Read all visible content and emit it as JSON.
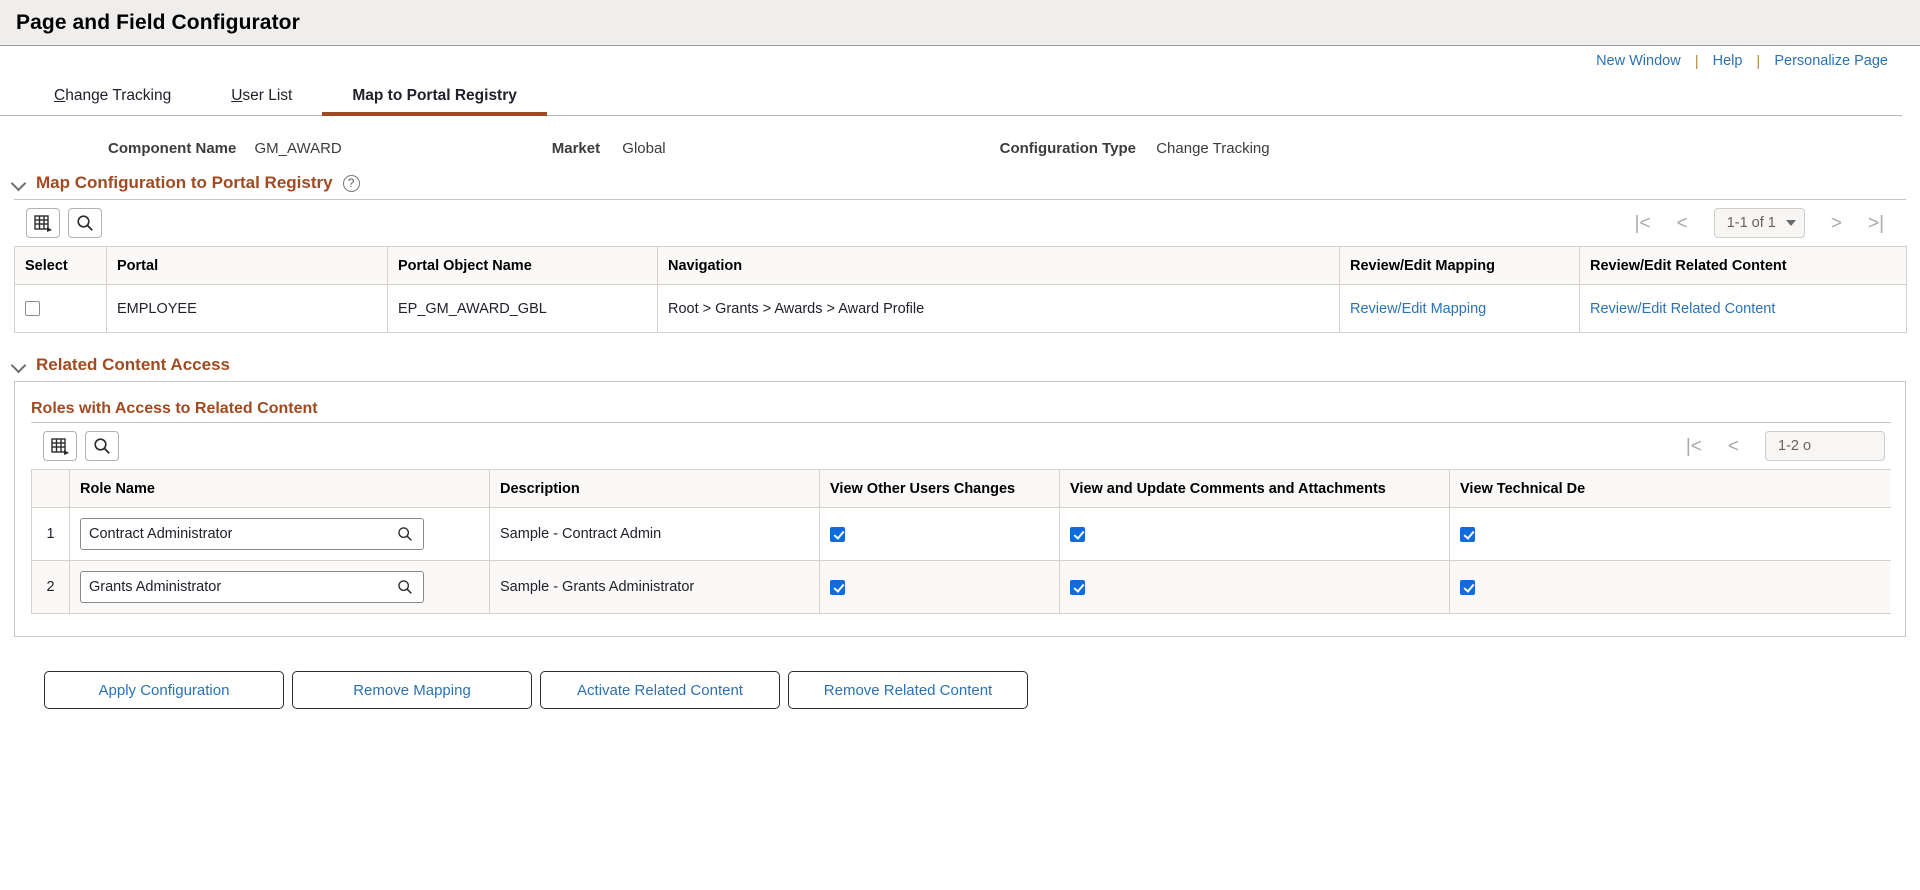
{
  "header": {
    "title": "Page and Field Configurator"
  },
  "utility_links": [
    {
      "label": "New Window"
    },
    {
      "label": "Help"
    },
    {
      "label": "Personalize Page"
    }
  ],
  "utility_separator": "|",
  "tabs": [
    {
      "label": "Change Tracking",
      "accesskey": "C",
      "active": false
    },
    {
      "label": "User List",
      "accesskey": "U",
      "active": false
    },
    {
      "label": "Map to Portal Registry",
      "accesskey": "",
      "active": true
    }
  ],
  "summary": {
    "component_name_label": "Component Name",
    "component_name_value": "GM_AWARD",
    "market_label": "Market",
    "market_value": "Global",
    "configuration_type_label": "Configuration Type",
    "configuration_type_value": "Change Tracking"
  },
  "map_section": {
    "title": "Map Configuration to Portal Registry",
    "help_glyph": "?",
    "toolbar": {
      "personalize_icon": "grid-personalize-icon",
      "find_icon": "search-icon"
    },
    "pager": {
      "first_label": "|<",
      "prev_label": "<",
      "range_label": "1-1 of 1",
      "next_label": ">",
      "last_label": ">|"
    },
    "columns": [
      "Select",
      "Portal",
      "Portal Object Name",
      "Navigation",
      "Review/Edit Mapping",
      "Review/Edit Related Content"
    ],
    "rows": [
      {
        "selected": false,
        "portal": "EMPLOYEE",
        "portal_object_name": "EP_GM_AWARD_GBL",
        "navigation": "Root > Grants > Awards > Award Profile",
        "review_edit_mapping": "Review/Edit Mapping",
        "review_edit_related_content": "Review/Edit Related Content"
      }
    ]
  },
  "related_content_section": {
    "title": "Related Content Access",
    "subtitle": "Roles with Access to Related Content",
    "toolbar": {
      "personalize_icon": "grid-personalize-icon",
      "find_icon": "search-icon"
    },
    "pager": {
      "first_label": "|<",
      "prev_label": "<",
      "range_label": "1-2 o"
    },
    "columns": [
      "",
      "Role Name",
      "Description",
      "View Other Users Changes",
      "View and Update Comments and Attachments",
      "View Technical De"
    ],
    "rows": [
      {
        "num": "1",
        "role_name": "Contract Administrator",
        "description": "Sample - Contract Admin",
        "view_other_users_changes": true,
        "view_update_comments": true,
        "view_technical_details": true
      },
      {
        "num": "2",
        "role_name": "Grants Administrator",
        "description": "Sample - Grants Administrator",
        "view_other_users_changes": true,
        "view_update_comments": true,
        "view_technical_details": true
      }
    ]
  },
  "actions": [
    {
      "label": "Apply Configuration"
    },
    {
      "label": "Remove Mapping"
    },
    {
      "label": "Activate Related Content"
    },
    {
      "label": "Remove Related Content"
    }
  ],
  "colors": {
    "accent_brown": "#a04b22",
    "link_blue": "#2a72b5",
    "checkbox_blue": "#0f6cdb",
    "header_bg": "#efeeec"
  }
}
